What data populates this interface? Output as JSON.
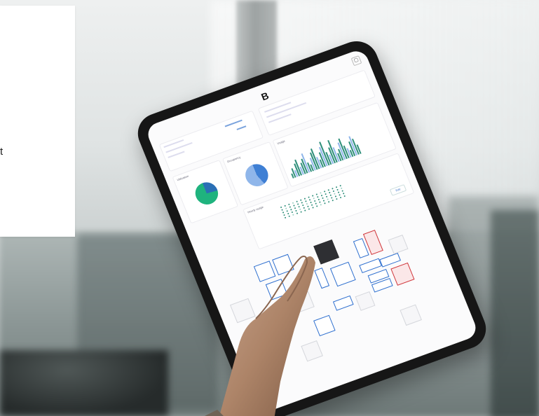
{
  "card": {
    "visible_text": "t"
  },
  "tablet": {
    "logo": "B",
    "corner_button": "▢",
    "chart_title_bars": "Usage",
    "chart_title_pie_left": "Utilization",
    "chart_title_pie_mid": "Occupancy",
    "chart_title_dots": "Hourly usage",
    "button_label": "Edit"
  },
  "colors": {
    "accent_blue": "#2e6fcf",
    "accent_green": "#1fb37e",
    "alert_red": "#d0363b",
    "bar_teal": "#2f8f7a"
  },
  "chart_data": [
    {
      "type": "pie",
      "slices": [
        0.26,
        0.74
      ],
      "colors": [
        "#2a6fb5",
        "#1fb37e"
      ]
    },
    {
      "type": "pie",
      "slices": [
        0.44,
        0.56
      ],
      "colors": [
        "#3e7fd4",
        "#8fb6ea"
      ]
    },
    {
      "type": "bar",
      "values": [
        3,
        6,
        4,
        8,
        10,
        5,
        7,
        9,
        12,
        6,
        4,
        8,
        11,
        13,
        7,
        5,
        9,
        12,
        15,
        8,
        6,
        10,
        14,
        9,
        5,
        7,
        11,
        13,
        8,
        6,
        4,
        9,
        12,
        10,
        6
      ],
      "colors": [
        "#2f8f7a",
        "#8fb6ea"
      ]
    }
  ]
}
